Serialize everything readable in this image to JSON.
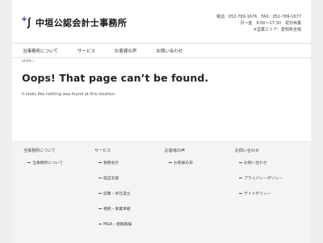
{
  "header": {
    "site_name": "中垣公認会計士事務所",
    "contact_line1": "電話：052-789-1676　FAX：052-789-1677",
    "contact_line2": "月〜金　9:00〜17:30　祝日休業",
    "contact_line3": "※営業エリア：愛知県全域"
  },
  "nav": {
    "items": [
      "当事務所について",
      "サービス",
      "お客様の声",
      "お問い合わせ"
    ]
  },
  "breadcrumb": "HOME /",
  "main": {
    "title": "Oops! That page can’t be found.",
    "message": "It looks like nothing was found at this location."
  },
  "footer": {
    "columns": [
      {
        "title": "当事務所について",
        "links": [
          "当事務所について"
        ]
      },
      {
        "title": "サービス",
        "links": [
          "税務会計",
          "経営支援",
          "創業・会社設立",
          "相続・事業承継",
          "M&A・組織再編"
        ]
      },
      {
        "title": "お客様の声",
        "links": [
          "お客様の声"
        ]
      },
      {
        "title": "お問い合わせ",
        "links": [
          "お問い合わせ",
          "プライバシーポリシー",
          "サイトポリシー"
        ]
      }
    ]
  },
  "colors": {
    "logo_accent": "#2b3f8a",
    "logo_dark": "#111111"
  },
  "icons": {
    "logo": "cross-and-hook-logo-icon"
  }
}
